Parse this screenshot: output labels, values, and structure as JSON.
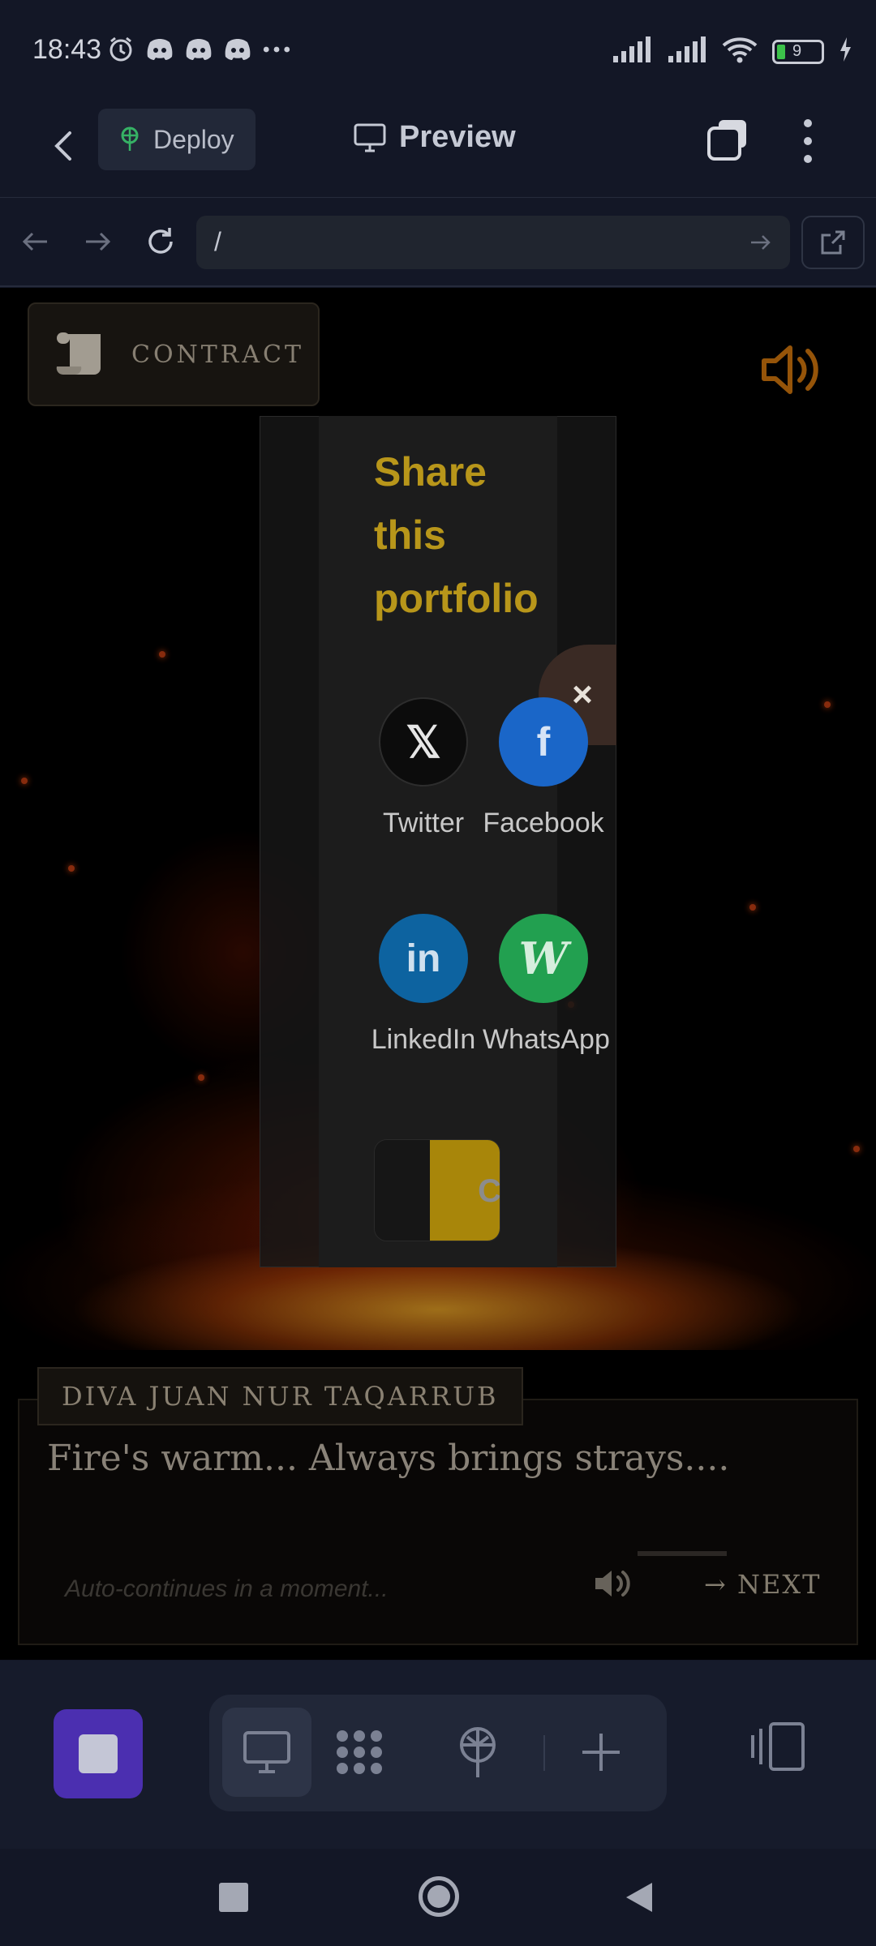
{
  "status_bar": {
    "time": "18:43",
    "left_icons": [
      "alarm-icon",
      "discord-icon",
      "discord-icon",
      "discord-icon",
      "more-dots-icon"
    ],
    "battery": "9"
  },
  "toolbar": {
    "deploy_label": "Deploy",
    "preview_label": "Preview"
  },
  "url_bar": {
    "url": "/"
  },
  "page": {
    "contract_label": "CONTRACT",
    "share_modal": {
      "title": "Share this portfolio",
      "close": "×",
      "items": [
        {
          "label": "Twitter",
          "glyph": "𝕏",
          "color": "#111111"
        },
        {
          "label": "Facebook",
          "glyph": "f",
          "color": "#1a66c8"
        },
        {
          "label": "LinkedIn",
          "glyph": "in",
          "color": "#0d63a0"
        },
        {
          "label": "WhatsApp",
          "glyph": "W",
          "color": "#22a050"
        }
      ],
      "copy_label": "C"
    },
    "dialogue": {
      "speaker": "DIVA JUAN NUR TAQARRUB",
      "text": "Fire's warm... Always brings strays....",
      "auto_hint": "Auto-continues in a moment...",
      "next_label": "→ NEXT"
    }
  },
  "colors": {
    "accent_gold": "#b8961a",
    "stop_purple": "#4b2fb0",
    "background": "#131726"
  }
}
